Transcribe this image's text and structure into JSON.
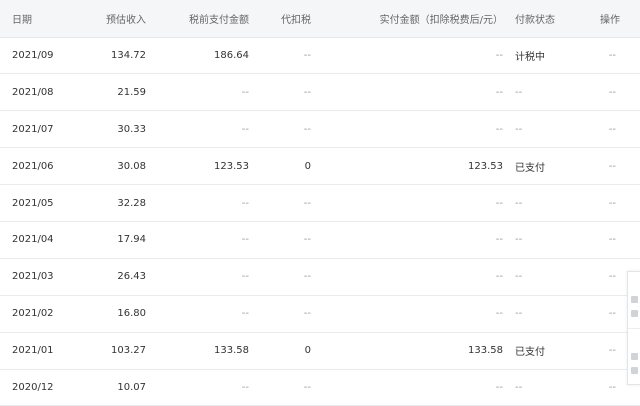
{
  "table": {
    "headers": {
      "date": "日期",
      "estimated_income": "预估收入",
      "pretax_paid": "税前支付金额",
      "withholding_tax": "代扣税",
      "actual_amount": "实付金额（扣除税费后/元）",
      "payment_status": "付款状态",
      "action": "操作"
    },
    "rows": [
      {
        "date": "2021/09",
        "estimated_income": "134.72",
        "pretax_paid": "186.64",
        "withholding_tax": "--",
        "actual_amount": "--",
        "payment_status": "计税中",
        "action": "--"
      },
      {
        "date": "2021/08",
        "estimated_income": "21.59",
        "pretax_paid": "--",
        "withholding_tax": "--",
        "actual_amount": "--",
        "payment_status": "--",
        "action": "--"
      },
      {
        "date": "2021/07",
        "estimated_income": "30.33",
        "pretax_paid": "--",
        "withholding_tax": "--",
        "actual_amount": "--",
        "payment_status": "--",
        "action": "--"
      },
      {
        "date": "2021/06",
        "estimated_income": "30.08",
        "pretax_paid": "123.53",
        "withholding_tax": "0",
        "actual_amount": "123.53",
        "payment_status": "已支付",
        "action": "--"
      },
      {
        "date": "2021/05",
        "estimated_income": "32.28",
        "pretax_paid": "--",
        "withholding_tax": "--",
        "actual_amount": "--",
        "payment_status": "--",
        "action": "--"
      },
      {
        "date": "2021/04",
        "estimated_income": "17.94",
        "pretax_paid": "--",
        "withholding_tax": "--",
        "actual_amount": "--",
        "payment_status": "--",
        "action": "--"
      },
      {
        "date": "2021/03",
        "estimated_income": "26.43",
        "pretax_paid": "--",
        "withholding_tax": "--",
        "actual_amount": "--",
        "payment_status": "--",
        "action": "--"
      },
      {
        "date": "2021/02",
        "estimated_income": "16.80",
        "pretax_paid": "--",
        "withholding_tax": "--",
        "actual_amount": "--",
        "payment_status": "--",
        "action": "--"
      },
      {
        "date": "2021/01",
        "estimated_income": "103.27",
        "pretax_paid": "133.58",
        "withholding_tax": "0",
        "actual_amount": "133.58",
        "payment_status": "已支付",
        "action": "--"
      },
      {
        "date": "2020/12",
        "estimated_income": "10.07",
        "pretax_paid": "--",
        "withholding_tax": "--",
        "actual_amount": "--",
        "payment_status": "--",
        "action": "--"
      }
    ]
  },
  "colors": {
    "header_bg": "#f5f6f8",
    "row_border": "#e9ebee",
    "text": "#333333",
    "muted": "#999999"
  }
}
